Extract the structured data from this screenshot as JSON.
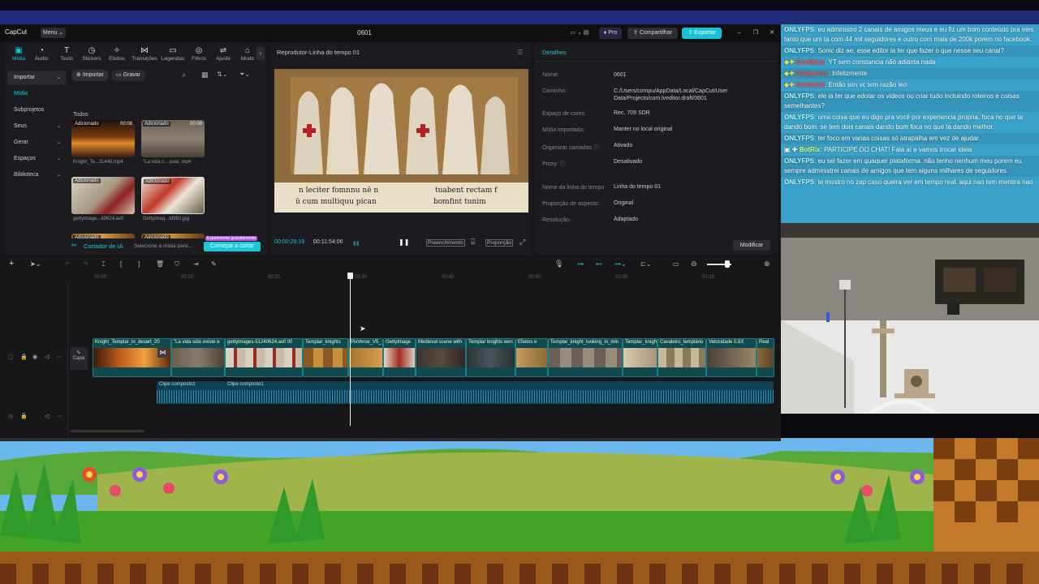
{
  "window": {
    "app_name": "CapCut",
    "menu_label": "Menu",
    "project_title": "0601",
    "pro_label": "Pro",
    "share_label": "Compartilhar",
    "export_label": "Exportar"
  },
  "asset_tabs": [
    {
      "label": "Mídia",
      "icon": "media-icon"
    },
    {
      "label": "Áudio",
      "icon": "audio-icon"
    },
    {
      "label": "Texto",
      "icon": "text-icon"
    },
    {
      "label": "Stickers",
      "icon": "sticker-icon"
    },
    {
      "label": "Efeitos",
      "icon": "effects-icon"
    },
    {
      "label": "Transições",
      "icon": "transitions-icon"
    },
    {
      "label": "Legendas",
      "icon": "captions-icon"
    },
    {
      "label": "Filtros",
      "icon": "filters-icon"
    },
    {
      "label": "Ajuste",
      "icon": "adjust-icon"
    },
    {
      "label": "Mode",
      "icon": "mode-icon"
    }
  ],
  "left_nav": [
    {
      "label": "Importar",
      "chev": "⌄"
    },
    {
      "label": "Mídia",
      "chev": ""
    },
    {
      "label": "Subprojetos",
      "chev": ""
    },
    {
      "label": "Seus",
      "chev": "⌄"
    },
    {
      "label": "Gerar",
      "chev": "⌄"
    },
    {
      "label": "Espaços",
      "chev": "⌄"
    },
    {
      "label": "Biblioteca",
      "chev": "⌄"
    }
  ],
  "media": {
    "import_label": "Importar",
    "record_label": "Gravar",
    "all_label": "Todos",
    "items": [
      {
        "badge": "Adicionado",
        "duration": "00:08",
        "caption": "Knight_Te...31448.mp4"
      },
      {
        "badge": "Adicionado",
        "duration": "00:09",
        "caption": "\"La vida s... paia .mp4"
      },
      {
        "badge": "Adicionado",
        "duration": "",
        "caption": "gettyimage...40624.avif"
      },
      {
        "badge": "Adicionado",
        "duration": "",
        "caption": "Gettyimag...td992.jpg"
      },
      {
        "badge": "Adicionado",
        "duration": "",
        "caption": ""
      },
      {
        "badge": "Adicionado",
        "duration": "",
        "caption": ""
      }
    ],
    "ai_cutter_label": "Cortador de IA",
    "ai_cutter_hint": "Selecione a mídia para...",
    "free_badge": "Experimente gratuitamente",
    "start_cut_label": "Começar a cortar"
  },
  "player": {
    "title": "Reprodutor-Linha do tempo 01",
    "text_left1": "n leciter fomnnu nē n",
    "text_left2": "ū cum multiquu pican",
    "text_right1": "tuabent rectam f",
    "text_right2": "bomfint tunim",
    "current_time": "00:00:29:19",
    "total_time": "00:11:54:06",
    "fill_label": "Preenchimento",
    "ratio_label": "Proporção"
  },
  "details": {
    "title": "Detalhes",
    "rows": [
      {
        "label": "Nome:",
        "value": "0601"
      },
      {
        "label": "Caminho:",
        "value": "C:/Users/compu/AppData/Local/CapCut/User Data/Projects/com.lveditor.draft/0601"
      },
      {
        "label": "Espaço de cores:",
        "value": "Rec. 709 SDR"
      },
      {
        "label": "Mídia importada:",
        "value": "Manter no local original"
      },
      {
        "label": "Organizar camadas ⓘ",
        "value": "Ativado"
      },
      {
        "label": "Proxy: ⓘ",
        "value": "Desativado"
      },
      {
        "label": "Nome da linha do tempo",
        "value": "Linha do tempo 01"
      },
      {
        "label": "Proporção de aspecto:",
        "value": "Original"
      },
      {
        "label": "Resolução:",
        "value": "Adaptado"
      }
    ],
    "modify_label": "Modificar"
  },
  "timeline": {
    "ruler": [
      "00:00",
      "00:10",
      "00:20",
      "00:30",
      "00:40",
      "00:50",
      "01:00",
      "01:10"
    ],
    "cover_label": "Capa",
    "clips": [
      "Knight_Templar_in_desert_20",
      "\"La vida sólo existe e",
      "gettyimages-51240624.avif 00",
      "Templar_knights",
      "PixVerse_V5_",
      "GettyImage",
      "Medieval scene with",
      "Templar knights wen",
      "Efeitos e",
      "Templar_knight_looking_in_min",
      "Templar_knigh",
      "Cavaleiro_templário",
      "Velocidade 0.8X",
      "Real"
    ],
    "audio_clips": [
      "Clipe composto1",
      "Clipe composto1"
    ]
  },
  "chat": [
    {
      "user": "ONLYFPS",
      "color": "blue",
      "text": ": eu administro 2 canais de amigos meus e eu fiz um bom conteúdo pra eles tanto que um ta com 44 mil seguidores e outro com mais de 200k porem no facebook."
    },
    {
      "user": "ONLYFPS",
      "color": "blue",
      "text": ": Sonic diz ae, esse editor ia ter que fazer o que nesse seu canal?"
    },
    {
      "user": "DanBatat",
      "color": "red",
      "text": ": YT sem constancia não adianta nada"
    },
    {
      "user": "Dudgamer",
      "color": "red",
      "text": ": Infelizmente"
    },
    {
      "user": "DanBatat",
      "color": "red",
      "text": ": Então sim vc tem razão leo"
    },
    {
      "user": "ONLYFPS",
      "color": "blue",
      "text": ": ele ia ter que edotar os videos ou criar tudo incluindo roteiros e coisas semelhantes?"
    },
    {
      "user": "ONLYFPS",
      "color": "blue",
      "text": ": uma coisa que eu digo pra você por experiencia propria, foca no que ta dando bom. se tem dois canais dando bom foca no que ta dando melhor."
    },
    {
      "user": "ONLYFPS",
      "color": "blue",
      "text": ": ter foco em varias coisas só atrapalha em vez de ajudar."
    },
    {
      "user": "BotRix",
      "color": "green",
      "text": ": PARTICIPE DO CHAT! Fala aí e vamos trocar ideia"
    },
    {
      "user": "ONLYFPS",
      "color": "blue",
      "text": ": eu sei fazer em quaquer plataforma. não tenho nenhum meu porem eu sempre administrei canais de amigos que tem alguns milhares de seguidores."
    },
    {
      "user": "ONLYFPS",
      "color": "blue",
      "text": ": te mostro no zap caso queira ver em tempo real. aqui nao tem mentira nao"
    }
  ],
  "colors": {
    "accent": "#00c4d4",
    "track": "#114a4e",
    "chat_bg": "#3aa1c9",
    "export": "#18c2d4"
  }
}
